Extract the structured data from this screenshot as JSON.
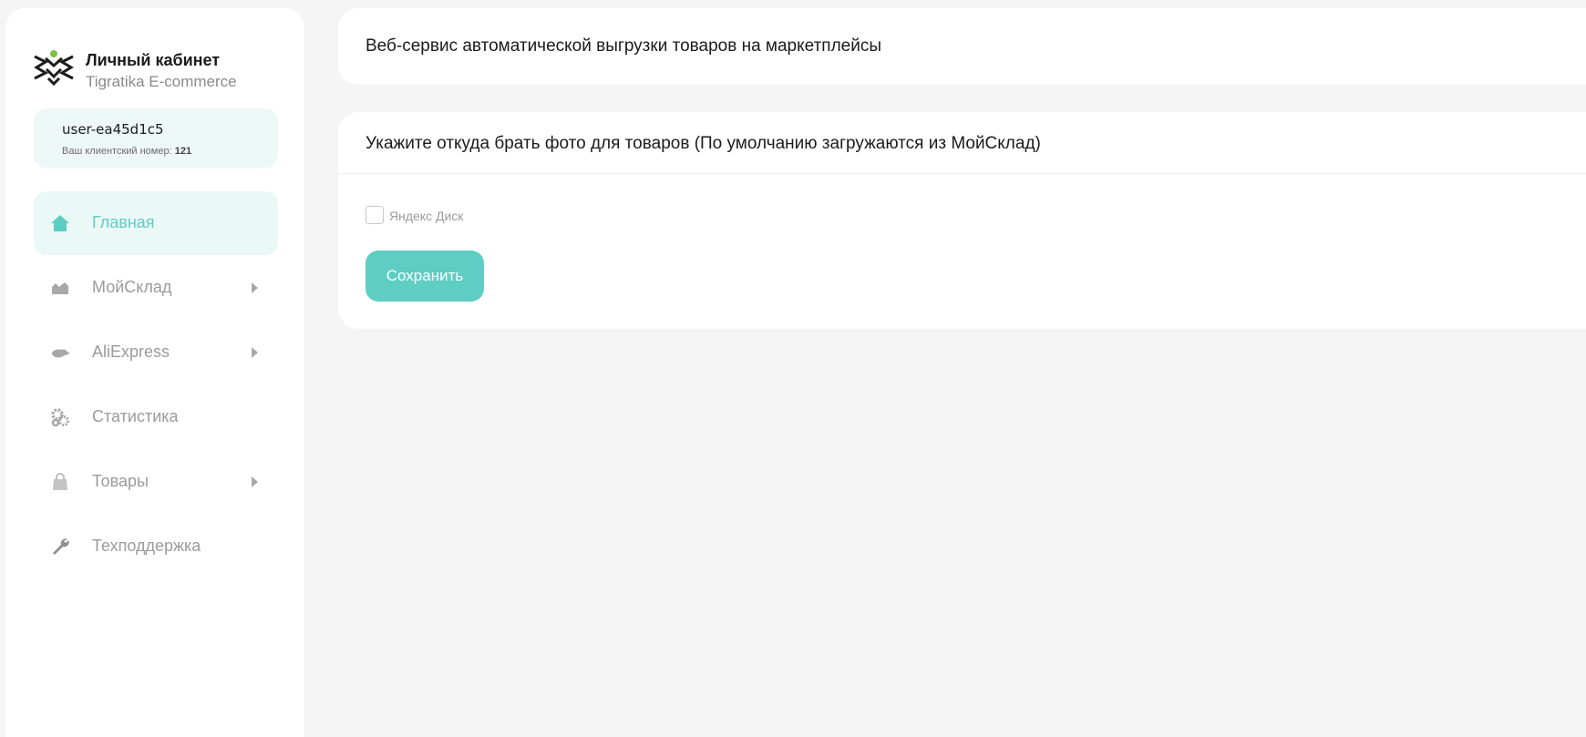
{
  "brand": {
    "title": "Личный кабинет",
    "subtitle": "Tigratika E-commerce",
    "logo_icon": "tigratika-logo-icon"
  },
  "user": {
    "name": "user-ea45d1c5",
    "client_label": "Ваш клиентский номер:",
    "client_number": "121"
  },
  "sidebar": {
    "items": [
      {
        "label": "Главная",
        "icon": "home-icon",
        "active": true,
        "has_submenu": false
      },
      {
        "label": "МойСклад",
        "icon": "warehouse-icon",
        "active": false,
        "has_submenu": true
      },
      {
        "label": "AliExpress",
        "icon": "cloud-icon",
        "active": false,
        "has_submenu": true
      },
      {
        "label": "Статистика",
        "icon": "cogs-icon",
        "active": false,
        "has_submenu": false
      },
      {
        "label": "Товары",
        "icon": "shopping-bag-icon",
        "active": false,
        "has_submenu": true
      },
      {
        "label": "Техподдержка",
        "icon": "wrench-icon",
        "active": false,
        "has_submenu": false
      }
    ]
  },
  "main": {
    "header_title": "Веб-сервис автоматической выгрузки товаров на маркетплейсы",
    "photo_source": {
      "title": "Укажите откуда брать фото для товаров (По умолчанию загружаются из МойСклад)",
      "option_label": "Яндекс Диск",
      "option_checked": false,
      "save_label": "Сохранить"
    }
  },
  "colors": {
    "accent": "#5ecdc3",
    "accent_light": "#eaf8f6",
    "background": "#f5f5f5",
    "logo_green": "#7cc242"
  }
}
